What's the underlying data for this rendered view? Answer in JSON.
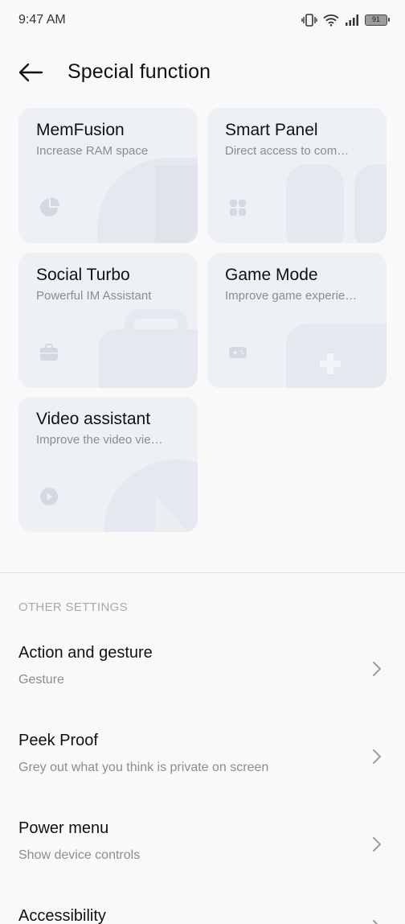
{
  "status": {
    "time": "9:47 AM",
    "battery": "91",
    "icons": [
      "vibrate-icon",
      "wifi-icon",
      "signal-icon",
      "battery-icon"
    ]
  },
  "header": {
    "title": "Special function",
    "back_icon": "back-arrow-icon"
  },
  "cards": [
    {
      "title": "MemFusion",
      "subtitle": "Increase RAM space",
      "icon": "pie-chart-icon"
    },
    {
      "title": "Smart Panel",
      "subtitle": "Direct access to com…",
      "icon": "grid-icon"
    },
    {
      "title": "Social Turbo",
      "subtitle": "Powerful IM Assistant",
      "icon": "briefcase-icon"
    },
    {
      "title": "Game Mode",
      "subtitle": "Improve game experie…",
      "icon": "gamepad-icon"
    },
    {
      "title": "Video assistant",
      "subtitle": "Improve the video vie…",
      "icon": "play-icon"
    }
  ],
  "other_settings": {
    "heading": "OTHER SETTINGS",
    "items": [
      {
        "title": "Action and gesture",
        "subtitle": "Gesture"
      },
      {
        "title": "Peek Proof",
        "subtitle": "Grey out what you think is private on screen"
      },
      {
        "title": "Power menu",
        "subtitle": "Show device controls"
      },
      {
        "title": "Accessibility",
        "subtitle": ""
      }
    ]
  },
  "colors": {
    "background": "#f9f9fa",
    "card": "#edf0f5",
    "icon_tint": "#d3d8e2",
    "subtext": "#8a8d95"
  }
}
